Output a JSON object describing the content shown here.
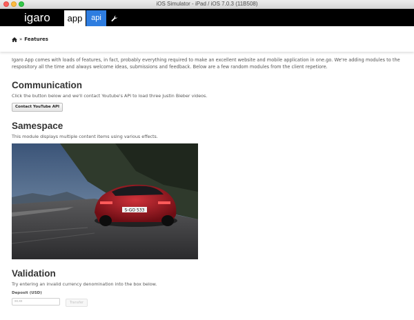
{
  "window": {
    "title": "iOS Simulator - iPad / iOS 7.0.3 (11B508)"
  },
  "nav": {
    "logo": "igaro",
    "tabs": [
      {
        "label": "app"
      },
      {
        "label": "api"
      }
    ],
    "tools_icon": "wrench-icon",
    "colors": {
      "bar": "#000000",
      "active_tab": "#ffffff",
      "api_tab": "#2e7de0"
    }
  },
  "breadcrumb": {
    "home_icon": "home-icon",
    "separator": "»",
    "current": "Features"
  },
  "intro": "Igaro App comes with loads of features, in fact, probably everything required to make an excellent website and mobile application in one.go. We're adding modules to the respository all the time and always welcome ideas, submissions and feedback. Below are a few random modules from the client repetiore.",
  "sections": {
    "communication": {
      "heading": "Communication",
      "description": "Click the button below and we'll contact Youtube's API to load three Justin Bieber videos.",
      "button": "Contact YouTube API"
    },
    "samespace": {
      "heading": "Samespace",
      "description": "This module displays multiple content items using various effects.",
      "image_plate": "S-GO 533"
    },
    "validation": {
      "heading": "Validation",
      "description": "Try entering an invalid currency denomination into the box below.",
      "field_label": "Deposit (USD)",
      "field_placeholder": "xx.xx",
      "button": "Transfer"
    }
  }
}
